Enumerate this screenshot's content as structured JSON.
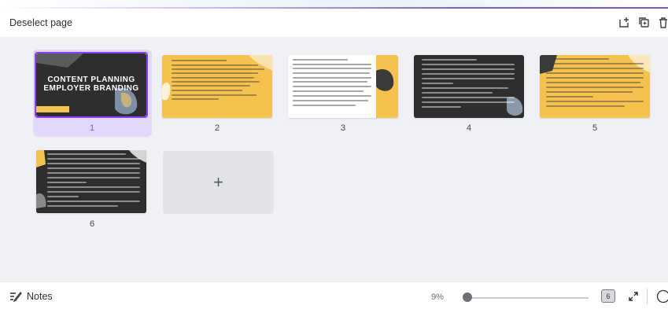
{
  "header": {
    "deselect_label": "Deselect page"
  },
  "pages": [
    {
      "number": "1",
      "title_line1": "CONTENT PLANNING",
      "title_line2": "EMPLOYER BRANDING"
    },
    {
      "number": "2"
    },
    {
      "number": "3"
    },
    {
      "number": "4"
    },
    {
      "number": "5"
    },
    {
      "number": "6"
    }
  ],
  "add_page": {
    "symbol": "+"
  },
  "footer": {
    "notes_label": "Notes",
    "zoom": "9%",
    "page_count": "6"
  },
  "colors": {
    "accent": "#8b3dff",
    "yellow": "#f5c24e",
    "dark": "#2b2b2b"
  }
}
